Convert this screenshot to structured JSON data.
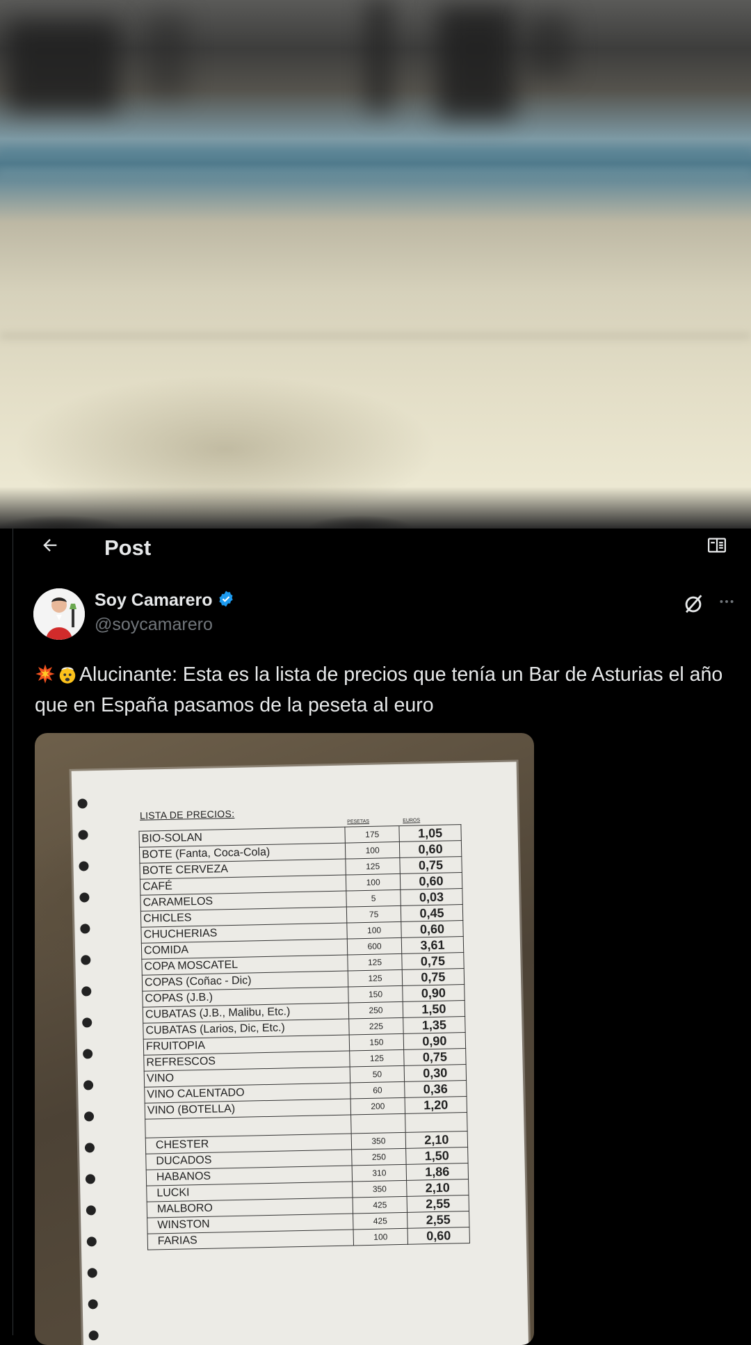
{
  "header": {
    "title": "Post"
  },
  "post": {
    "author_name": "Soy Camarero",
    "author_handle": "@soycamarero",
    "text": "Alucinante: Esta es la lista de precios que tenía un Bar de Asturias el año que en España pasamos de la peseta al euro",
    "image": {
      "list_title": "LISTA DE PRECIOS:",
      "col_pesetas": "PESETAS",
      "col_euros": "EUROS",
      "rows": [
        {
          "item": "BIO-SOLAN",
          "pesetas": "175",
          "euros": "1,05"
        },
        {
          "item": "BOTE  (Fanta, Coca-Cola)",
          "pesetas": "100",
          "euros": "0,60"
        },
        {
          "item": "BOTE CERVEZA",
          "pesetas": "125",
          "euros": "0,75"
        },
        {
          "item": "CAFÉ",
          "pesetas": "100",
          "euros": "0,60"
        },
        {
          "item": "CARAMELOS",
          "pesetas": "5",
          "euros": "0,03"
        },
        {
          "item": "CHICLES",
          "pesetas": "75",
          "euros": "0,45"
        },
        {
          "item": "CHUCHERIAS",
          "pesetas": "100",
          "euros": "0,60"
        },
        {
          "item": "COMIDA",
          "pesetas": "600",
          "euros": "3,61"
        },
        {
          "item": "COPA  MOSCATEL",
          "pesetas": "125",
          "euros": "0,75"
        },
        {
          "item": "COPAS   (Coñac - Dic)",
          "pesetas": "125",
          "euros": "0,75"
        },
        {
          "item": "COPAS   (J.B.)",
          "pesetas": "150",
          "euros": "0,90"
        },
        {
          "item": "CUBATAS  (J.B., Malibu, Etc.)",
          "pesetas": "250",
          "euros": "1,50"
        },
        {
          "item": "CUBATAS  (Larios, Dic, Etc.)",
          "pesetas": "225",
          "euros": "1,35"
        },
        {
          "item": "FRUITOPIA",
          "pesetas": "150",
          "euros": "0,90"
        },
        {
          "item": "REFRESCOS",
          "pesetas": "125",
          "euros": "0,75"
        },
        {
          "item": "VINO",
          "pesetas": "50",
          "euros": "0,30"
        },
        {
          "item": "VINO  CALENTADO",
          "pesetas": "60",
          "euros": "0,36"
        },
        {
          "item": "VINO  (BOTELLA)",
          "pesetas": "200",
          "euros": "1,20"
        }
      ],
      "tobacco_rows": [
        {
          "item": "CHESTER",
          "pesetas": "350",
          "euros": "2,10"
        },
        {
          "item": "DUCADOS",
          "pesetas": "250",
          "euros": "1,50"
        },
        {
          "item": "HABANOS",
          "pesetas": "310",
          "euros": "1,86"
        },
        {
          "item": "LUCKI",
          "pesetas": "350",
          "euros": "2,10"
        },
        {
          "item": "MALBORO",
          "pesetas": "425",
          "euros": "2,55"
        },
        {
          "item": "WINSTON",
          "pesetas": "425",
          "euros": "2,55"
        },
        {
          "item": "FARIAS",
          "pesetas": "100",
          "euros": "0,60"
        }
      ]
    }
  },
  "icons": {
    "back": "arrow-left-icon",
    "reader": "book-open-icon",
    "verified": "verified-badge-icon",
    "grok": "grok-icon",
    "more": "more-icon",
    "emoji1": "collision-emoji-icon",
    "emoji2": "exploding-head-emoji-icon"
  },
  "colors": {
    "background": "#000000",
    "text": "#e7e9ea",
    "secondary_text": "#71767b",
    "verified": "#1d9bf0"
  }
}
